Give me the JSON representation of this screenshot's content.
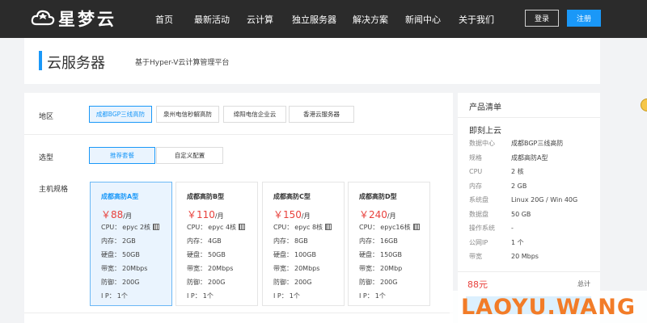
{
  "brand": {
    "name": "星梦云"
  },
  "nav": {
    "items": [
      "首页",
      "最新活动",
      "云计算",
      "独立服务器",
      "解决方案",
      "新闻中心",
      "关于我们"
    ],
    "login": "登录",
    "register": "注册"
  },
  "page": {
    "title": "云服务器",
    "subtitle": "基于Hyper-V云计算管理平台"
  },
  "config": {
    "region_label": "地区",
    "regions": [
      "成都BGP三线高防",
      "泉州电信秒解高防",
      "绵阳电信企业云",
      "香港云服务器"
    ],
    "selected_region": 0,
    "type_label": "选型",
    "types": [
      "推荐套餐",
      "自定义配置"
    ],
    "selected_type": 0,
    "spec_label": "主机规格",
    "spec_keys": {
      "cpu": "CPU：",
      "mem": "内存：",
      "disk": "硬盘：",
      "bw": "带宽：",
      "ddos": "防御：",
      "ip": "I P："
    },
    "plans": [
      {
        "name": "成都高防A型",
        "price": "￥88",
        "unit": "/月",
        "cpu": "epyc 2核",
        "mem": "2GB",
        "disk": "50GB",
        "bw": "20Mbps",
        "ddos": "200G",
        "ip": "1个"
      },
      {
        "name": "成都高防B型",
        "price": "￥110",
        "unit": "/月",
        "cpu": "epyc 4核",
        "mem": "4GB",
        "disk": "50GB",
        "bw": "20Mbps",
        "ddos": "200G",
        "ip": "1个"
      },
      {
        "name": "成都高防C型",
        "price": "￥150",
        "unit": "/月",
        "cpu": "epyc 8核",
        "mem": "8GB",
        "disk": "100GB",
        "bw": "20Mbps",
        "ddos": "200G",
        "ip": "1个"
      },
      {
        "name": "成都高防D型",
        "price": "￥240",
        "unit": "/月",
        "cpu": "epyc16核",
        "mem": "16GB",
        "disk": "150GB",
        "bw": "20Mbp",
        "ddos": "200G",
        "ip": "1个"
      }
    ],
    "selected_plan": 0
  },
  "summary": {
    "heading": "产品清单",
    "subheading": "即刻上云",
    "rows": [
      {
        "k": "数据中心",
        "v": "成都BGP三线高防"
      },
      {
        "k": "规格",
        "v": "成都高防A型"
      },
      {
        "k": "CPU",
        "v": "2 核"
      },
      {
        "k": "内存",
        "v": "2 GB"
      },
      {
        "k": "系统盘",
        "v": "Linux 20G / Win 40G"
      },
      {
        "k": "数据盘",
        "v": "50 GB"
      },
      {
        "k": "操作系统",
        "v": "-"
      },
      {
        "k": "公网IP",
        "v": "1 个"
      },
      {
        "k": "带宽",
        "v": "20 Mbps"
      }
    ],
    "total": "88元",
    "total_label": "总计"
  },
  "watermark": "LAOYU.WANG",
  "colors": {
    "accent": "#1a98f8",
    "price": "#e8413c",
    "nav_bg": "#2b2b2b",
    "watermark": "#f27c28"
  }
}
